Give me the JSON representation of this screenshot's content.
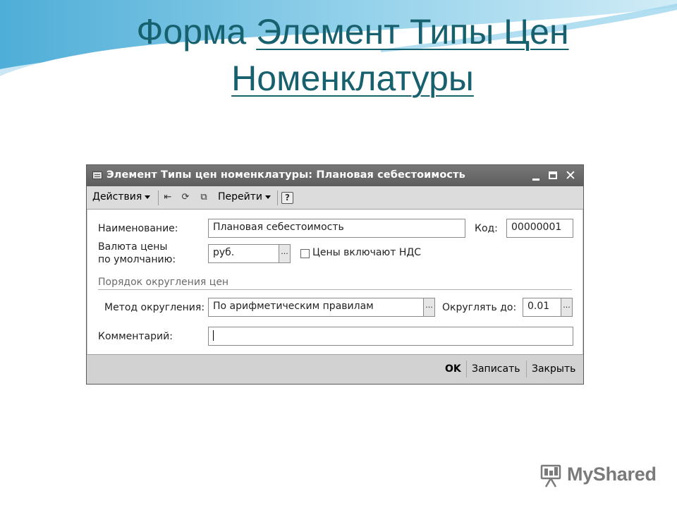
{
  "slide": {
    "title_part1": "Форма ",
    "title_part2": "Элемент Типы Цен",
    "title_part3": "Номенклатуры"
  },
  "window": {
    "title": "Элемент Типы цен номенклатуры: Плановая себестоимость",
    "controls": {
      "minimize": "_",
      "maximize": "□",
      "close": "✕"
    }
  },
  "toolbar": {
    "actions_label": "Действия",
    "goto_label": "Перейти",
    "icons": [
      "arrow-left-icon",
      "refresh-icon",
      "copy-icon",
      "help-icon"
    ],
    "help_glyph": "?"
  },
  "form": {
    "name_label": "Наименование:",
    "name_value": "Плановая себестоимость",
    "code_label": "Код:",
    "code_value": "00000001",
    "currency_label_line1": "Валюта цены",
    "currency_label_line2": "по умолчанию:",
    "currency_value": "руб.",
    "vat_checkbox_label": "Цены включают НДС",
    "vat_checked": false,
    "rounding_section": "Порядок округления цен",
    "rounding_method_label": "Метод округления:",
    "rounding_method_value": "По арифметическим правилам",
    "round_to_label": "Округлять до:",
    "round_to_value": "0.01",
    "comment_label": "Комментарий:",
    "comment_value": "",
    "picker_glyph": "..."
  },
  "footer": {
    "ok_label": "OK",
    "save_label": "Записать",
    "close_label": "Закрыть"
  },
  "brand": {
    "text": "MyShared"
  },
  "colors": {
    "title": "#17606e",
    "titlebar": "#666666",
    "swoosh": "#4fb3d9"
  }
}
